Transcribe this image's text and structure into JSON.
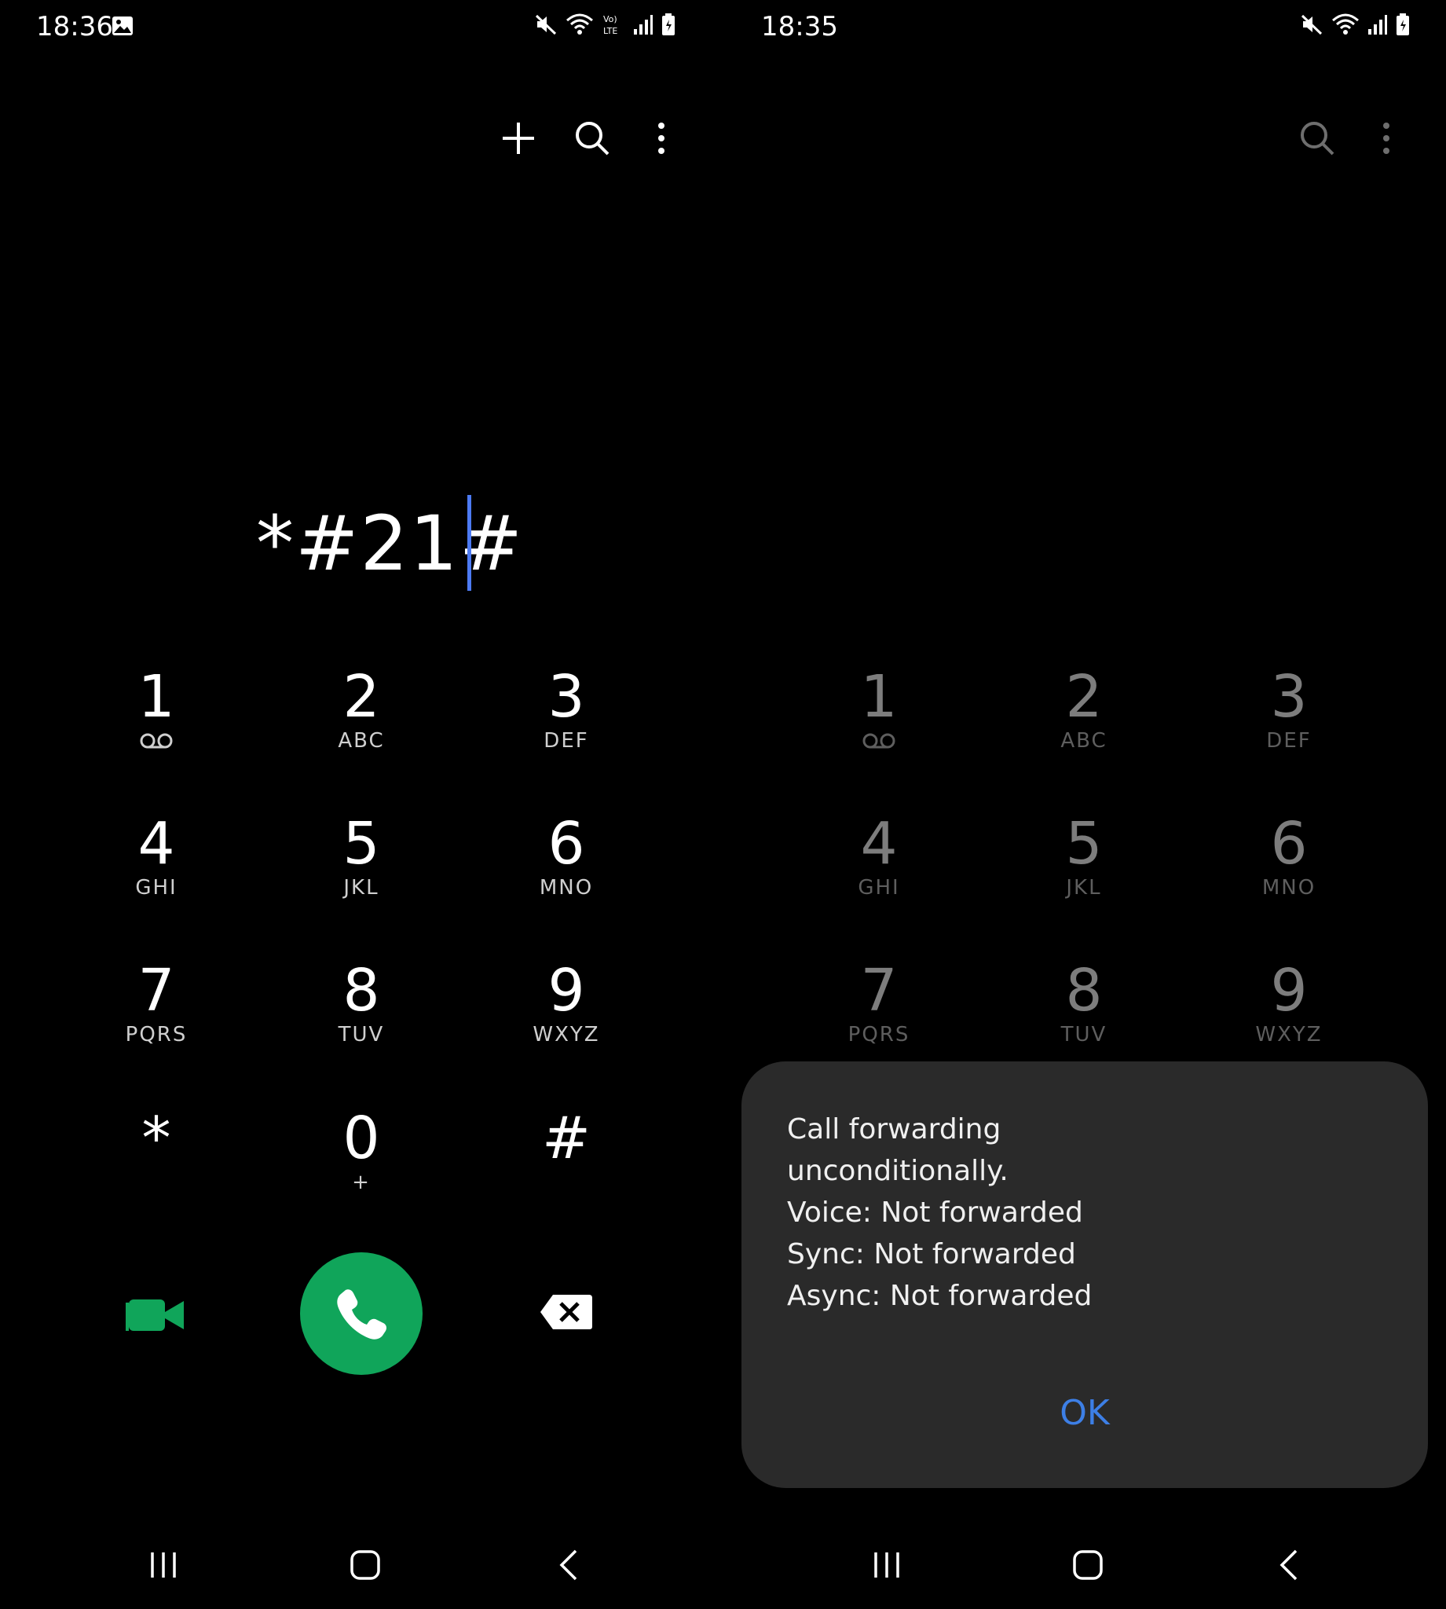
{
  "left": {
    "status": {
      "time": "18:36"
    },
    "number_display": "*#21#",
    "keypad": [
      {
        "digit": "1",
        "letters": ""
      },
      {
        "digit": "2",
        "letters": "ABC"
      },
      {
        "digit": "3",
        "letters": "DEF"
      },
      {
        "digit": "4",
        "letters": "GHI"
      },
      {
        "digit": "5",
        "letters": "JKL"
      },
      {
        "digit": "6",
        "letters": "MNO"
      },
      {
        "digit": "7",
        "letters": "PQRS"
      },
      {
        "digit": "8",
        "letters": "TUV"
      },
      {
        "digit": "9",
        "letters": "WXYZ"
      },
      {
        "digit": "*",
        "letters": ""
      },
      {
        "digit": "0",
        "letters": "+"
      },
      {
        "digit": "#",
        "letters": ""
      }
    ]
  },
  "right": {
    "status": {
      "time": "18:35"
    },
    "keypad": [
      {
        "digit": "1",
        "letters": ""
      },
      {
        "digit": "2",
        "letters": "ABC"
      },
      {
        "digit": "3",
        "letters": "DEF"
      },
      {
        "digit": "4",
        "letters": "GHI"
      },
      {
        "digit": "5",
        "letters": "JKL"
      },
      {
        "digit": "6",
        "letters": "MNO"
      },
      {
        "digit": "7",
        "letters": "PQRS"
      },
      {
        "digit": "8",
        "letters": "TUV"
      },
      {
        "digit": "9",
        "letters": "WXYZ"
      }
    ],
    "dialog": {
      "lines": [
        "Call forwarding",
        "unconditionally.",
        "Voice: Not forwarded",
        "Sync: Not forwarded",
        "Async: Not forwarded"
      ],
      "ok_label": "OK"
    }
  },
  "colors": {
    "call_green": "#10a55a",
    "accent_blue": "#3d7fe6",
    "cursor_blue": "#4d7bf3",
    "dialog_bg": "#2a2a2a"
  },
  "icons": [
    "gallery-icon",
    "mute-icon",
    "wifi-icon",
    "volte-icon",
    "signal-icon",
    "battery-icon",
    "add-icon",
    "search-icon",
    "more-icon",
    "voicemail-icon",
    "video-call-icon",
    "phone-icon",
    "backspace-icon",
    "recents-icon",
    "home-icon",
    "back-icon"
  ]
}
